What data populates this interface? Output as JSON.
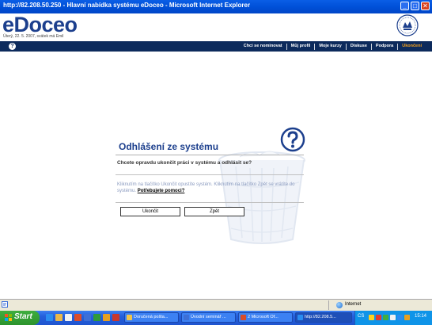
{
  "window": {
    "title": "http://82.208.50.250 - Hlavní nabídka systému eDoceo - Microsoft Internet Explorer",
    "minimize": "_",
    "maximize": "□",
    "close": "✕"
  },
  "header": {
    "logo": "eDoceo",
    "date": "Úterý, 22. 5. 2007, svátek má Emil",
    "crest_icon": "university-crest-icon"
  },
  "nav": {
    "help_icon": "?",
    "items": [
      {
        "label": "Chci se nominovat"
      },
      {
        "label": "Můj profil"
      },
      {
        "label": "Moje kurzy"
      },
      {
        "label": "Diskuse"
      },
      {
        "label": "Podpora"
      },
      {
        "label": "Ukončení",
        "active": true
      }
    ],
    "active_color": "#f7a21b"
  },
  "dialog": {
    "title": "Odhlášení ze systému",
    "question_icon": "question-mark-icon",
    "question": "Chcete opravdu ukončit práci v systému a odhlásit se?",
    "info": "Kliknutím na tlačítko Ukončit opustíte systém. Kliknutím na tlačítko Zpět se vrátíte do systému.",
    "help_link": "Potřebujete pomoci?",
    "buttons": {
      "logout": "Ukončit",
      "back": "Zpět"
    }
  },
  "statusbar": {
    "zone": "Internet"
  },
  "taskbar": {
    "start": "Start",
    "tasks": [
      {
        "label": "Doručená pošta..."
      },
      {
        "label": "Úvodní seminář ..."
      },
      {
        "label": "2 Microsoft Of..."
      },
      {
        "label": "http://82.208.5..."
      }
    ],
    "tray": {
      "lang": "CS",
      "clock": "15:14"
    }
  },
  "colors": {
    "brand": "#1c3f8d",
    "navbar": "#0c2a5c",
    "titlebar": "#0050d8"
  }
}
